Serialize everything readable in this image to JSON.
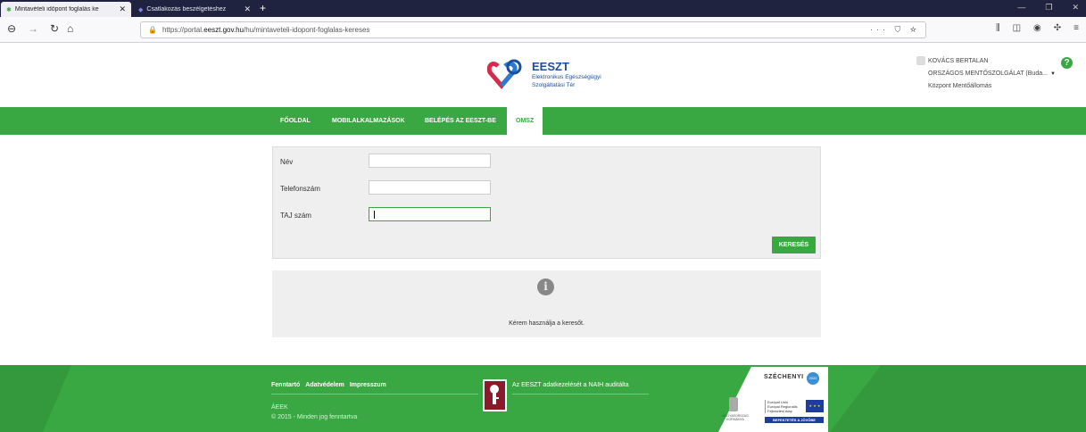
{
  "browser": {
    "tabs": [
      {
        "title": "Mintavételi időpont foglalás ke",
        "close": "✕"
      },
      {
        "title": "Csatlakozás beszélgetéshez",
        "close": "✕"
      }
    ],
    "new_tab": "+",
    "url_prefix": "https://portal.",
    "url_domain": "eeszt.gov.hu",
    "url_path": "/hu/mintaveteli-idopont-foglalas-kereses",
    "url_actions": "··· ⛉ ☆"
  },
  "header": {
    "logo_title": "EESZT",
    "logo_sub1": "Elektronikus Egészségügyi",
    "logo_sub2": "Szolgáltatási Tér",
    "user_name": "KOVÁCS BERTALAN",
    "user_org": "ORSZÁGOS MENTŐSZOLGÁLAT (Buda...",
    "user_unit": "Központ Mentőállomás",
    "help": "?",
    "dropdown": "▼"
  },
  "menu": {
    "items": [
      "FŐOLDAL",
      "MOBILALKALMAZÁSOK",
      "BELÉPÉS AZ EESZT-BE",
      "OMSZ"
    ]
  },
  "form": {
    "name_label": "Név",
    "name_value": "",
    "phone_label": "Telefonszám",
    "phone_value": "",
    "taj_label": "TAJ szám",
    "taj_value": "",
    "search_button": "KERESÉS"
  },
  "info": {
    "icon": "i",
    "message": "Kérem használja a keresőt."
  },
  "footer": {
    "links": [
      "Fenntartó",
      "Adatvédelem",
      "Impresszum"
    ],
    "org": "ÁEEK",
    "copyright": "© 2015 - Minden jog fenntartva",
    "naih_text": "Az EESZT adatkezelését a NAIH auditálta",
    "szechenyi": "SZÉCHENYI",
    "szechenyi_badge": "2020",
    "crest_text": "MAGYARORSZÁG KORMÁNYA",
    "eu_text1": "Európai Unió",
    "eu_text2": "Európai Regionális",
    "eu_text3": "Fejlesztési Alap",
    "eu_band": "BEFEKTETÉS A JÖVŐBE"
  },
  "colors": {
    "brand_green": "#3aa842",
    "logo_blue": "#1a4fa0",
    "naih_red": "#8b1a2a"
  }
}
